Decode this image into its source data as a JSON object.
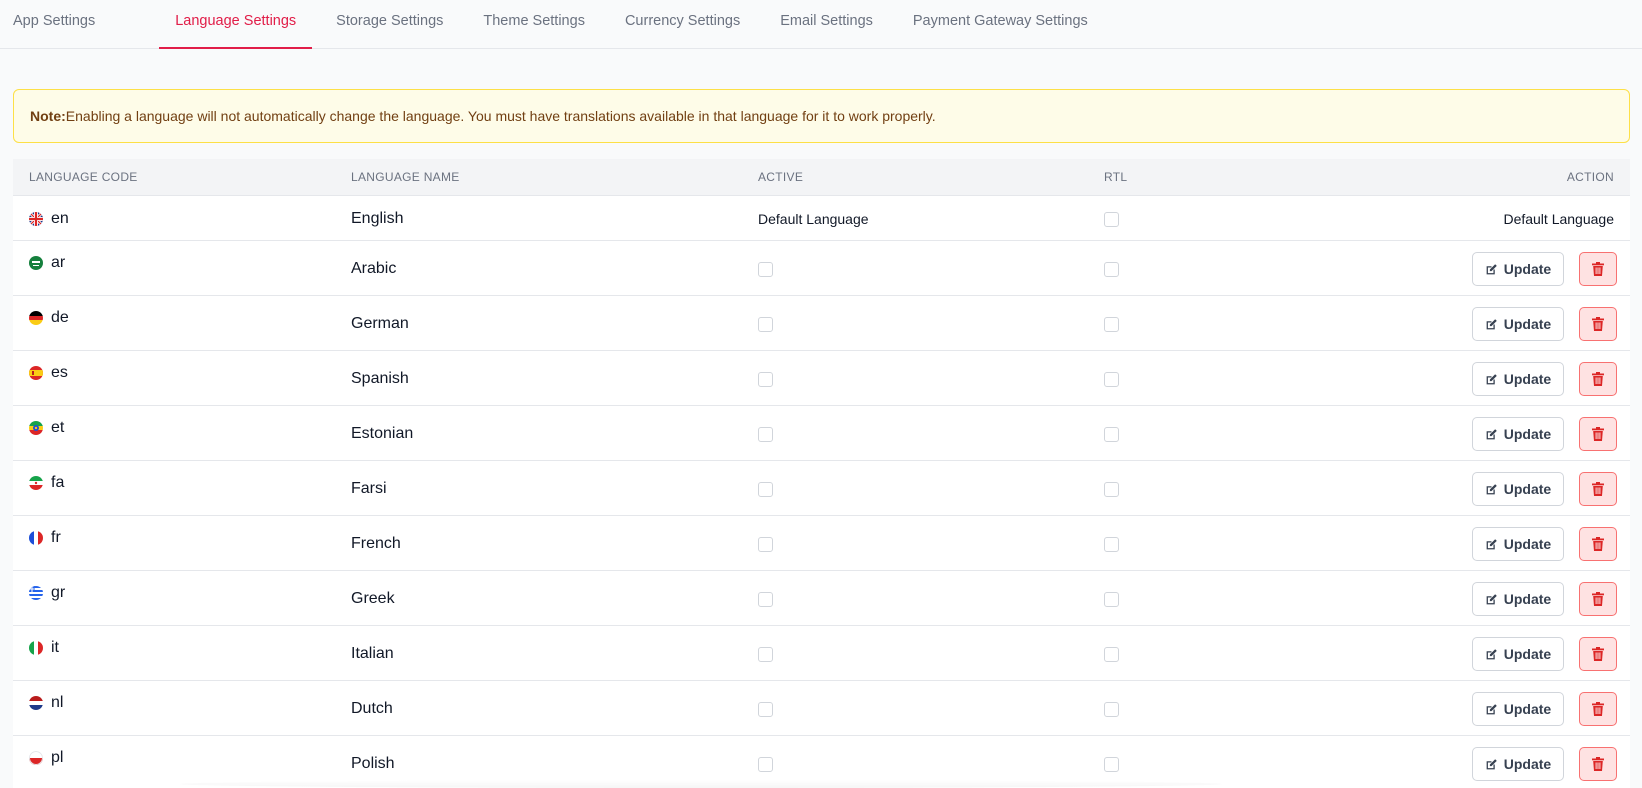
{
  "tabs": [
    {
      "label": "App Settings",
      "active": false
    },
    {
      "label": "Language Settings",
      "active": true
    },
    {
      "label": "Storage Settings",
      "active": false
    },
    {
      "label": "Theme Settings",
      "active": false
    },
    {
      "label": "Currency Settings",
      "active": false
    },
    {
      "label": "Email Settings",
      "active": false
    },
    {
      "label": "Payment Gateway Settings",
      "active": false
    }
  ],
  "note": {
    "label": "Note:",
    "text": "Enabling a language will not automatically change the language. You must have translations available in that language for it to work properly."
  },
  "table": {
    "headers": {
      "code": "LANGUAGE CODE",
      "name": "LANGUAGE NAME",
      "active": "ACTIVE",
      "rtl": "RTL",
      "action": "ACTION"
    },
    "default_row": {
      "code": "en",
      "name": "English",
      "flag": "flag-uk-icon",
      "active_text": "Default Language",
      "action_text": "Default Language"
    },
    "rows": [
      {
        "code": "ar",
        "name": "Arabic",
        "flag": "flag-saudi-icon"
      },
      {
        "code": "de",
        "name": "German",
        "flag": "flag-germany-icon"
      },
      {
        "code": "es",
        "name": "Spanish",
        "flag": "flag-spain-icon"
      },
      {
        "code": "et",
        "name": "Estonian",
        "flag": "flag-ethiopia-icon"
      },
      {
        "code": "fa",
        "name": "Farsi",
        "flag": "flag-iran-icon"
      },
      {
        "code": "fr",
        "name": "French",
        "flag": "flag-france-icon"
      },
      {
        "code": "gr",
        "name": "Greek",
        "flag": "flag-greece-icon"
      },
      {
        "code": "it",
        "name": "Italian",
        "flag": "flag-italy-icon"
      },
      {
        "code": "nl",
        "name": "Dutch",
        "flag": "flag-netherlands-icon"
      },
      {
        "code": "pl",
        "name": "Polish",
        "flag": "flag-poland-icon"
      }
    ],
    "update_label": "Update"
  },
  "colors": {
    "accent": "#e11d48",
    "delete": "#dc2626"
  }
}
